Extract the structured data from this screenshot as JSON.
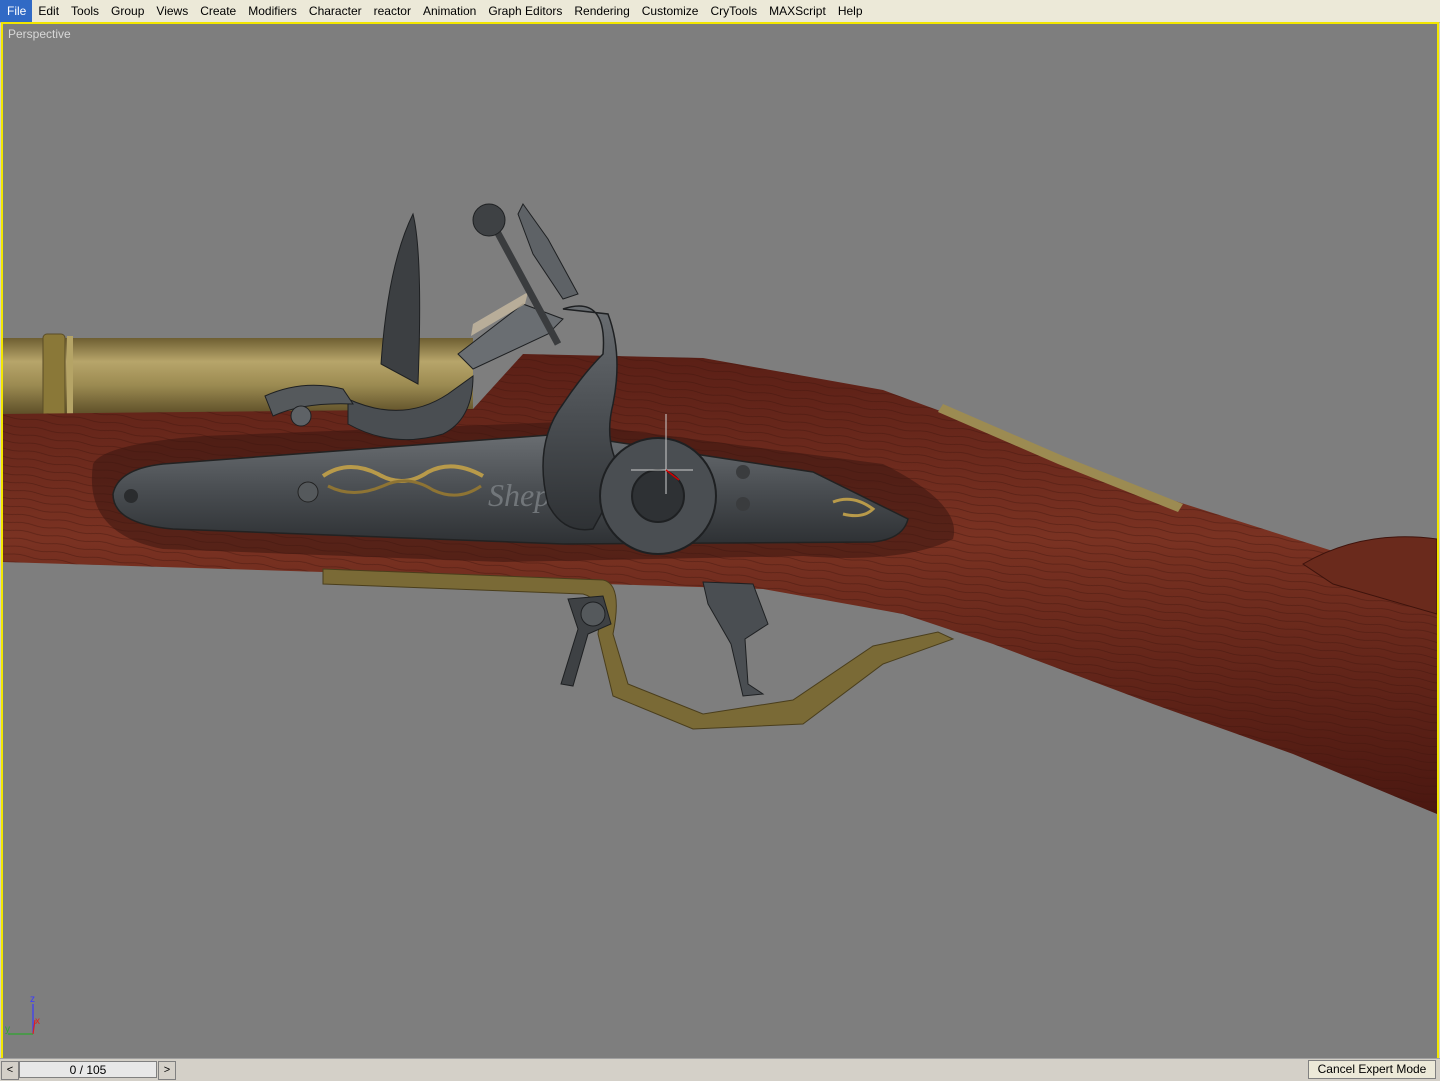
{
  "menu": {
    "items": [
      "File",
      "Edit",
      "Tools",
      "Group",
      "Views",
      "Create",
      "Modifiers",
      "Character",
      "reactor",
      "Animation",
      "Graph Editors",
      "Rendering",
      "Customize",
      "CryTools",
      "MAXScript",
      "Help"
    ]
  },
  "viewport": {
    "label": "Perspective",
    "border_color": "#f2e600",
    "background": "#7e7e7e",
    "engraving_text": "Shep",
    "axis": {
      "z": "z",
      "x": "x",
      "y": "y"
    }
  },
  "timeline": {
    "prev_symbol": "<",
    "next_symbol": ">",
    "frame_label": "0 / 105"
  },
  "expert_mode": {
    "label": "Cancel Expert Mode"
  },
  "colors": {
    "wood": "#6e2a1e",
    "brass": "#8e7a3a",
    "steel": "#4a4e52"
  }
}
